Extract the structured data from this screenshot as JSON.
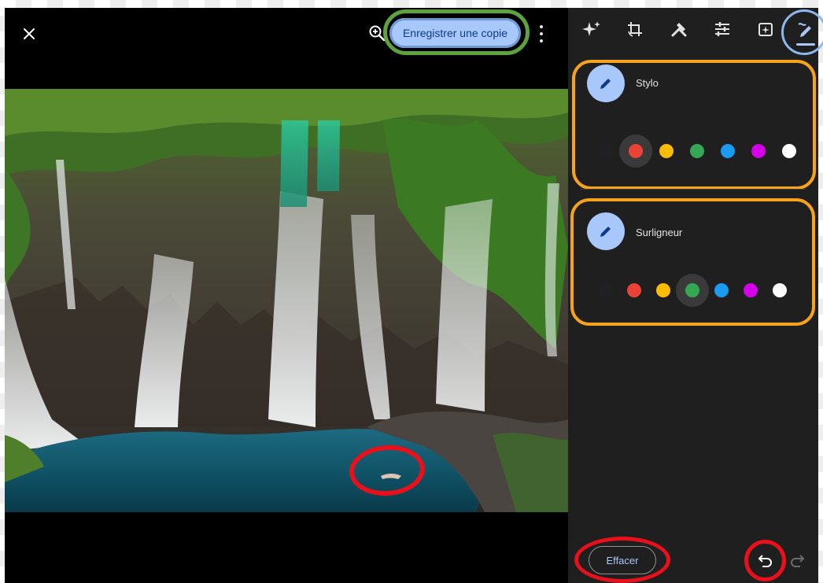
{
  "header": {
    "save_copy_label": "Enregistrer une copie",
    "close_icon": "close-icon",
    "zoom_icon": "zoom-in-icon",
    "more_icon": "more-vertical-icon"
  },
  "toolbar": {
    "tools": [
      {
        "name": "auto-enhance",
        "icon": "sparkle-icon"
      },
      {
        "name": "crop-rotate",
        "icon": "crop-rotate-icon"
      },
      {
        "name": "tools",
        "icon": "tools-icon"
      },
      {
        "name": "adjust",
        "icon": "sliders-icon"
      },
      {
        "name": "filters",
        "icon": "filter-icon"
      },
      {
        "name": "markup",
        "icon": "markup-pen-icon",
        "active": true
      }
    ]
  },
  "markup": {
    "pen": {
      "label": "Stylo",
      "colors": [
        "#202124",
        "#ea4335",
        "#fbbc04",
        "#34a853",
        "#1a9bf0",
        "#d400e8",
        "#ffffff"
      ],
      "selected_index": 1
    },
    "highlighter": {
      "label": "Surligneur",
      "colors": [
        "#202124",
        "#ea4335",
        "#fbbc04",
        "#34a853",
        "#1a9bf0",
        "#d400e8",
        "#ffffff"
      ],
      "selected_index": 3
    },
    "clear_label": "Effacer",
    "undo_icon": "undo-icon",
    "redo_icon": "redo-icon"
  },
  "colors": {
    "accent": "#a8c7fa",
    "panel_bg": "#1f1f1f",
    "annotation_green": "#5ea23f",
    "annotation_orange": "#f7a31a",
    "annotation_red": "#e8101a",
    "annotation_blue": "#8cb8ee"
  }
}
